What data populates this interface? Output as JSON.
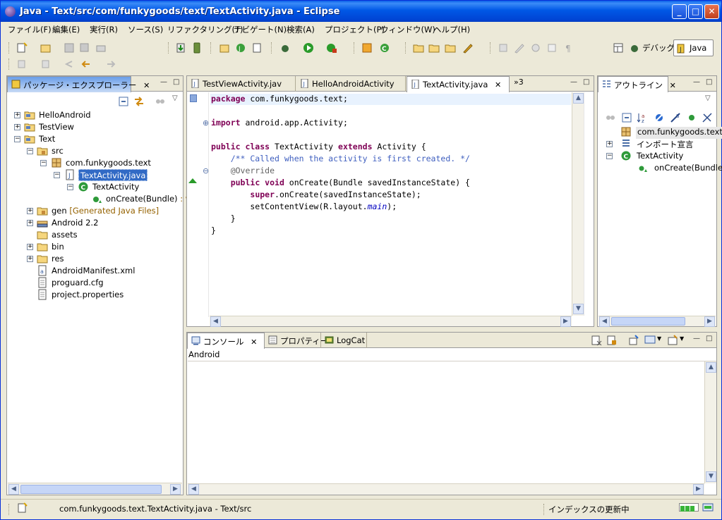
{
  "window": {
    "title": "Java - Text/src/com/funkygoods/text/TextActivity.java - Eclipse",
    "min_label": "_",
    "max_label": "□",
    "close_label": "✕"
  },
  "menu": [
    "ファイル(F)",
    "編集(E)",
    "実行(R)",
    "ソース(S)",
    "リファクタリング(T)",
    "ナビゲート(N)",
    "検索(A)",
    "プロジェクト(P)",
    "ウィンドウ(W)",
    "ヘルプ(H)"
  ],
  "perspectives": {
    "debug": "デバッグ",
    "java": "Java"
  },
  "package_explorer": {
    "tab_label": "パッケージ・エクスプローラー",
    "tree": [
      {
        "label": "HelloAndroid",
        "expander": "+"
      },
      {
        "label": "TestView",
        "expander": "+"
      },
      {
        "label": "Text",
        "expander": "−"
      },
      {
        "label": "src",
        "expander": "−"
      },
      {
        "label": "com.funkygoods.text",
        "expander": "−"
      },
      {
        "label": "TextActivity.java",
        "expander": "−"
      },
      {
        "label": "TextActivity",
        "expander": "−"
      },
      {
        "label": "onCreate(Bundle)",
        "suffix": ": vo"
      },
      {
        "label": "gen",
        "suffix": "[Generated Java Files]",
        "expander": "+"
      },
      {
        "label": "Android 2.2",
        "expander": "+"
      },
      {
        "label": "assets"
      },
      {
        "label": "bin",
        "expander": "+"
      },
      {
        "label": "res",
        "expander": "+"
      },
      {
        "label": "AndroidManifest.xml"
      },
      {
        "label": "proguard.cfg"
      },
      {
        "label": "project.properties"
      }
    ]
  },
  "editor": {
    "tabs": [
      "TestViewActivity.jav",
      "HelloAndroidActivity",
      "TextActivity.java"
    ],
    "overflow": "»3",
    "code": {
      "l1_kw": "package",
      "l1_rest": " com.funkygoods.text;",
      "l2_kw": "import",
      "l2_rest": " android.app.Activity;",
      "l3_kw1": "public class",
      "l3_mid": " TextActivity ",
      "l3_kw2": "extends",
      "l3_rest": " Activity {",
      "l4_comment": "    /** Called when the activity is first created. */",
      "l5_annotation": "    @Override",
      "l6_pre": "    ",
      "l6_kw": "public void",
      "l6_rest": " onCreate(Bundle savedInstanceState) {",
      "l7_pre": "        ",
      "l7_kw": "super",
      "l7_rest": ".onCreate(savedInstanceState);",
      "l8_pre": "        setContentView(R.layout.",
      "l8_field": "main",
      "l8_rest": ");",
      "l9": "    }",
      "l10": "}"
    }
  },
  "outline": {
    "tab_label": "アウトライン",
    "items": [
      {
        "label": "com.funkygoods.text"
      },
      {
        "label": "インポート宣言",
        "expander": "+"
      },
      {
        "label": "TextActivity",
        "expander": "−"
      },
      {
        "label": "onCreate(Bundle)"
      }
    ]
  },
  "bottom": {
    "tabs": [
      "コンソール",
      "プロパティー",
      "LogCat"
    ],
    "console_text": "Android"
  },
  "status": {
    "left": "com.funkygoods.text.TextActivity.java - Text/src",
    "right": "インデックスの更新中"
  },
  "colors": {
    "title_blue": "#0058e6",
    "selection": "#316ac5",
    "keyword": "#7f0055",
    "comment": "#3f5fbf"
  }
}
